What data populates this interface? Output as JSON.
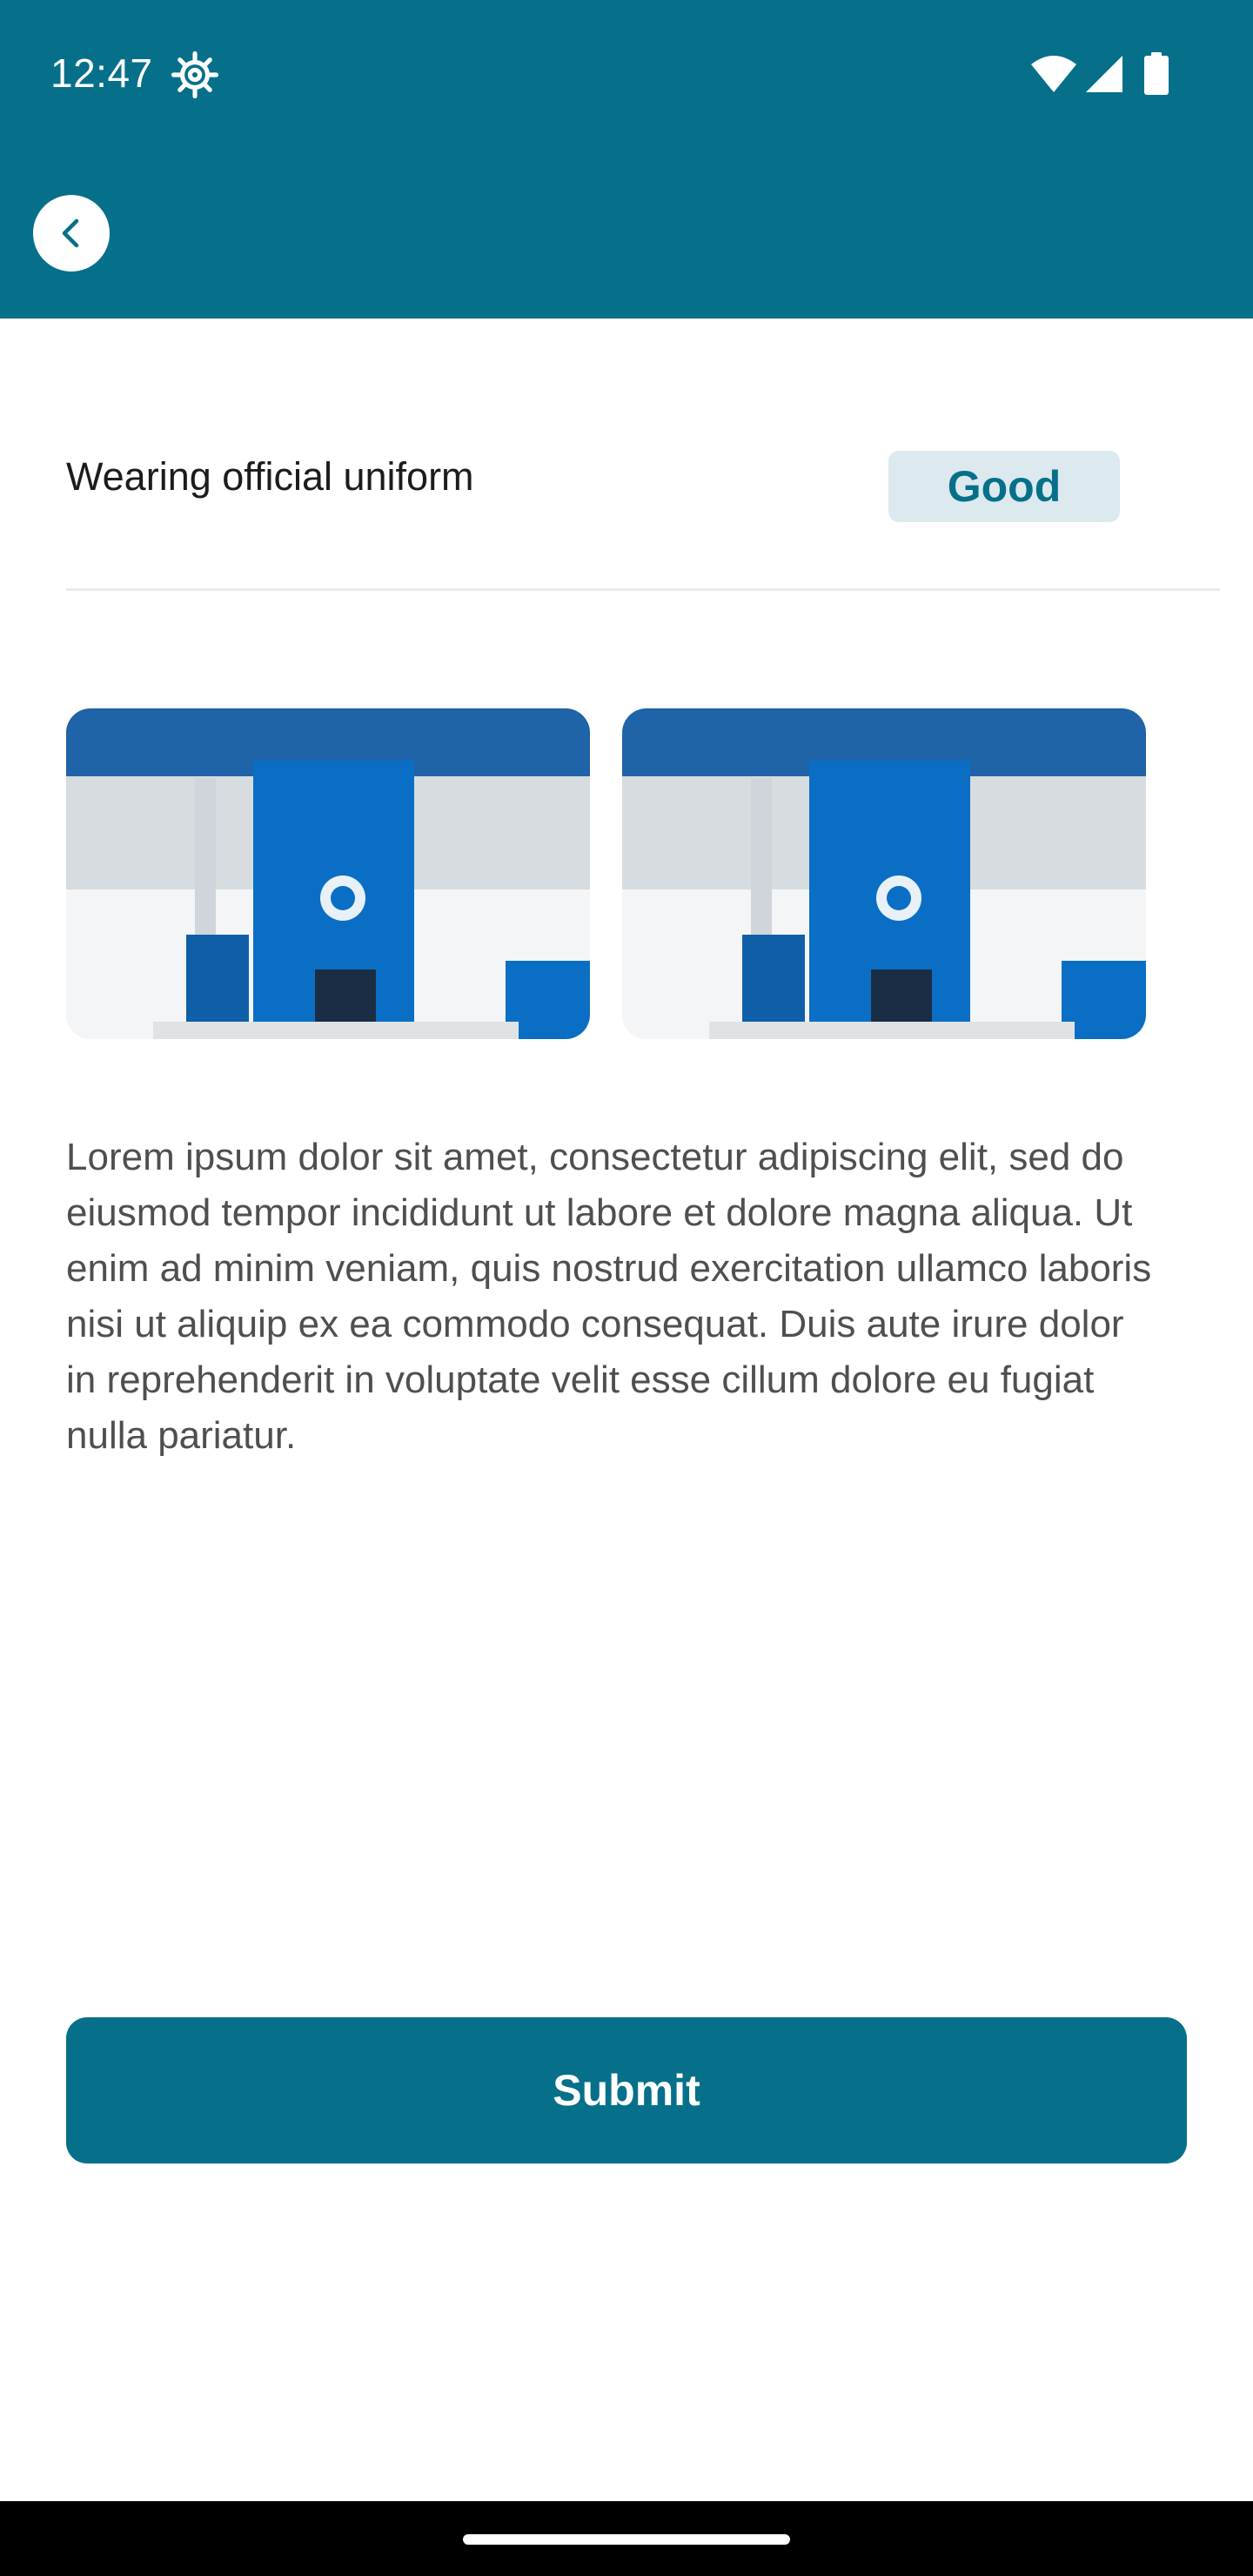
{
  "status_bar": {
    "time": "12:47",
    "icons": [
      "gear-icon",
      "wifi-icon",
      "signal-icon",
      "battery-icon"
    ]
  },
  "header": {
    "back_icon": "chevron-left-icon"
  },
  "item": {
    "label": "Wearing official uniform",
    "status": "Good"
  },
  "photos": [
    {
      "subject": "fuel-station-photo"
    },
    {
      "subject": "fuel-station-photo"
    }
  ],
  "description": "Lorem ipsum dolor sit amet, consectetur adipiscing elit, sed do eiusmod tempor incididunt ut labore et dolore magna aliqua. Ut enim ad minim veniam, quis nostrud exercitation ullamco laboris nisi ut aliquip ex ea commodo consequat. Duis aute irure dolor in reprehenderit in voluptate velit esse cillum dolore eu fugiat nulla pariatur.",
  "actions": {
    "submit_label": "Submit"
  },
  "colors": {
    "primary": "#06708A",
    "badge_bg": "#DCE9EE",
    "text_dark": "#1C1C1C",
    "text_body": "#4F4F4F",
    "background": "#FFFFFF"
  }
}
